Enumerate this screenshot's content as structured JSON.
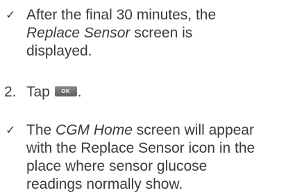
{
  "items": [
    {
      "marker_icon": "check-icon",
      "marker_glyph": "✓",
      "lines": [
        {
          "text": "After the final 30 minutes, the"
        },
        {
          "em": "Replace Sensor",
          "after": " screen is"
        },
        {
          "text": "displayed."
        }
      ]
    },
    {
      "number": "2.",
      "before": "Tap ",
      "button_label": "OK",
      "after": "."
    },
    {
      "marker_icon": "check-icon",
      "marker_glyph": "✓",
      "lines": [
        {
          "before": "The ",
          "em": "CGM Home",
          "after": " screen will appear"
        },
        {
          "text": "with the Replace Sensor icon in the"
        },
        {
          "text": "place where sensor glucose"
        },
        {
          "text": "readings normally show."
        }
      ]
    }
  ]
}
